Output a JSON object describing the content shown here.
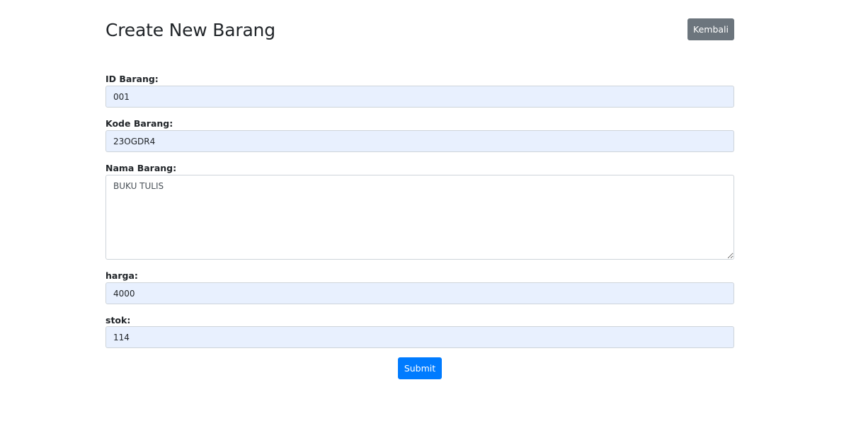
{
  "header": {
    "title": "Create New Barang",
    "back_label": "Kembali"
  },
  "form": {
    "id_barang": {
      "label": "ID Barang:",
      "value": "001"
    },
    "kode_barang": {
      "label": "Kode Barang:",
      "value": "23OGDR4"
    },
    "nama_barang": {
      "label": "Nama Barang:",
      "value": "BUKU TULIS"
    },
    "harga": {
      "label": "harga:",
      "value": "4000"
    },
    "stok": {
      "label": "stok:",
      "value": "114"
    },
    "submit_label": "Submit"
  },
  "colors": {
    "primary": "#007bff",
    "secondary": "#6c757d",
    "autofill_background": "#e8f0fe"
  }
}
